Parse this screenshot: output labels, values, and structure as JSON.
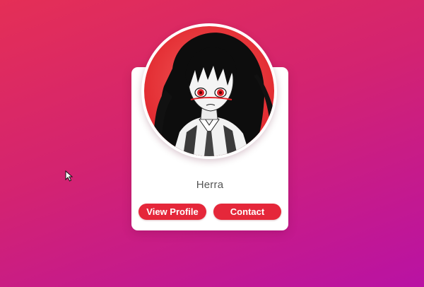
{
  "profile_card": {
    "name": "Herra",
    "view_profile_label": "View Profile",
    "contact_label": "Contact"
  },
  "colors": {
    "background_start": "#e42f56",
    "background_end": "#b912a4",
    "button": "#e5273a",
    "card": "#ffffff"
  },
  "icons": {
    "avatar": "anime-girl-portrait",
    "cursor": "mouse-pointer-icon"
  }
}
